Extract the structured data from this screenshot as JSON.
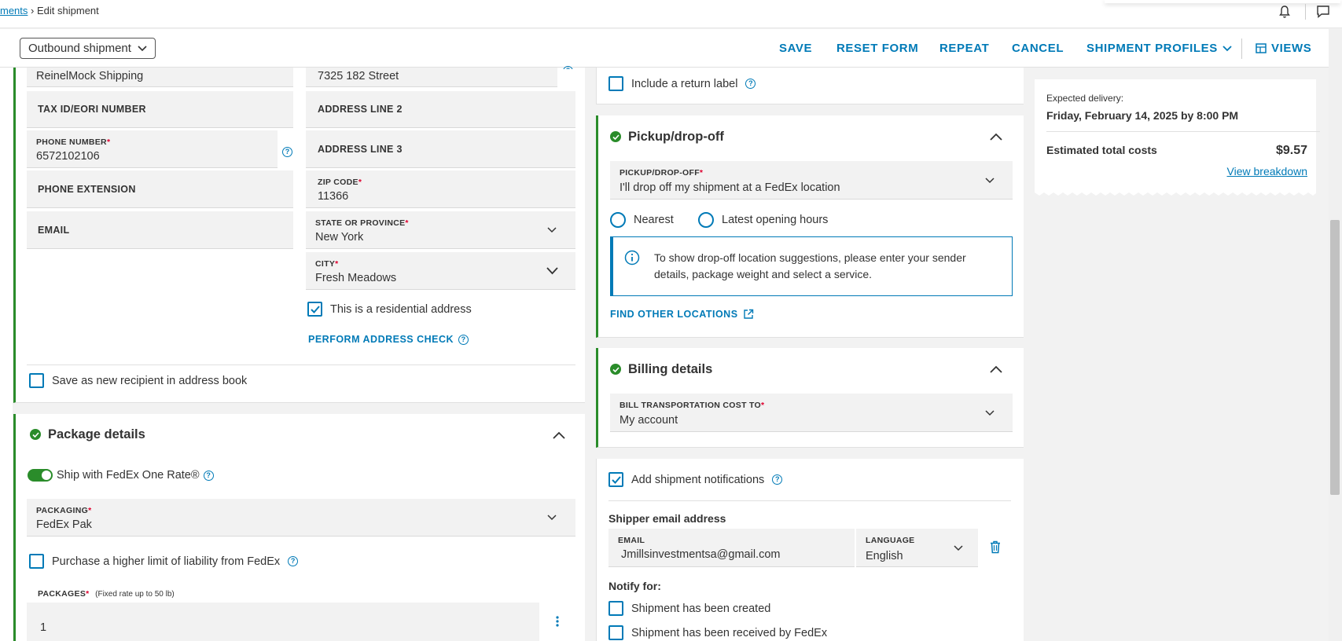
{
  "breadcrumb": {
    "link": "ments",
    "separator": "›",
    "current": "Edit shipment"
  },
  "toolbar": {
    "shipment_type": "Outbound shipment",
    "save": "SAVE",
    "reset": "RESET FORM",
    "repeat": "REPEAT",
    "cancel": "CANCEL",
    "profiles": "SHIPMENT PROFILES",
    "views": "VIEWS"
  },
  "recipient": {
    "company_value": "ReinelMock Shipping",
    "tax_id_label": "TAX ID/EORI NUMBER",
    "phone_label": "PHONE NUMBER",
    "phone_value": "6572102106",
    "phone_ext_label": "PHONE EXTENSION",
    "email_label": "EMAIL",
    "address1_value": "7325 182 Street",
    "address2_label": "ADDRESS LINE 2",
    "address3_label": "ADDRESS LINE 3",
    "zip_label": "ZIP CODE",
    "zip_value": "11366",
    "state_label": "STATE OR PROVINCE",
    "state_value": "New York",
    "city_label": "CITY",
    "city_value": "Fresh Meadows",
    "residential_label": "This is a residential address",
    "address_check": "PERFORM ADDRESS CHECK",
    "save_recipient": "Save as new recipient in address book"
  },
  "package": {
    "title": "Package details",
    "one_rate": "Ship with FedEx One Rate®",
    "packaging_label": "PACKAGING",
    "packaging_value": "FedEx Pak",
    "liability": "Purchase a higher limit of liability from FedEx",
    "packages_label": "PACKAGES",
    "packages_note": "(Fixed rate up to 50 lb)",
    "packages_value": "1"
  },
  "return_label": "Include a return label",
  "pickup": {
    "title": "Pickup/drop-off",
    "field_label": "PICKUP/DROP-OFF",
    "field_value": "I'll drop off my shipment at a FedEx location",
    "nearest": "Nearest",
    "latest": "Latest opening hours",
    "info": "To show drop-off location suggestions, please enter your sender details, package weight and select a service.",
    "find_other": "FIND OTHER LOCATIONS"
  },
  "billing": {
    "title": "Billing details",
    "field_label": "BILL TRANSPORTATION COST TO",
    "field_value": "My account"
  },
  "notifications": {
    "add": "Add shipment notifications",
    "shipper_email_title": "Shipper email address",
    "email_label": "EMAIL",
    "email_value": "Jmillsinvestmentsa@gmail.com",
    "language_label": "LANGUAGE",
    "language_value": "English",
    "notify_for": "Notify for:",
    "created": "Shipment has been created",
    "received": "Shipment has been received by FedEx"
  },
  "summary": {
    "expected_label": "Expected delivery:",
    "expected_value": "Friday, February 14, 2025 by 8:00 PM",
    "total_label": "Estimated total costs",
    "total_value": "$9.57",
    "breakdown": "View breakdown"
  },
  "colors": {
    "accent": "#007ab7",
    "success": "#2a8c2a",
    "required": "#de002e"
  }
}
